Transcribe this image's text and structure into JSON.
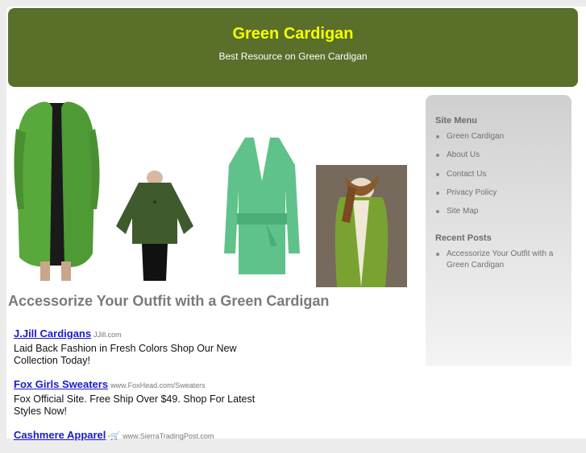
{
  "header": {
    "title": "Green Cardigan",
    "tagline": "Best Resource on Green Cardigan"
  },
  "post": {
    "title": "Accessorize Your Outfit with a Green Cardigan"
  },
  "ads": [
    {
      "title": "J.Jill Cardigans",
      "url": "JJill.com",
      "desc": "Laid Back Fashion in Fresh Colors Shop Our New Collection Today!"
    },
    {
      "title": "Fox Girls Sweaters",
      "url": "www.FoxHead.com/Sweaters",
      "desc": "Fox Official Site. Free Ship Over $49. Shop For Latest Styles Now!"
    },
    {
      "title": "Cashmere Apparel",
      "url": "www.SierraTradingPost.com",
      "desc": ""
    }
  ],
  "sidebar": {
    "menu_heading": "Site Menu",
    "menu": [
      "Green Cardigan",
      "About Us",
      "Contact Us",
      "Privacy Policy",
      "Site Map"
    ],
    "recent_heading": "Recent Posts",
    "recent": [
      "Accessorize Your Outfit with a Green Cardigan"
    ]
  },
  "colors": {
    "header_bg": "#5a6f2a",
    "title": "#f5ff00",
    "link": "#1a1acc"
  }
}
